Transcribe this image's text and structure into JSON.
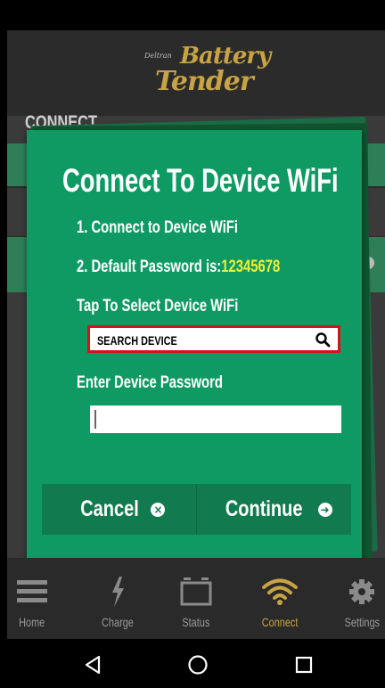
{
  "header": {
    "logo_small": "Deltran",
    "logo_line1": "Battery",
    "logo_line2": "Tender"
  },
  "page": {
    "title": "CONNECT"
  },
  "dialog": {
    "title": "Connect To Device WiFi",
    "step1": "1. Connect to Device WiFi",
    "step2_label": "2. Default Password is:",
    "step2_password": "12345678",
    "select_label": "Tap To Select Device WiFi",
    "search_placeholder": "SEARCH DEVICE",
    "password_label": "Enter Device Password",
    "password_value": "",
    "cancel_label": "Cancel",
    "continue_label": "Continue"
  },
  "tabs": [
    {
      "label": "Home",
      "icon": "menu-icon"
    },
    {
      "label": "Charge",
      "icon": "lightning-icon"
    },
    {
      "label": "Status",
      "icon": "battery-icon"
    },
    {
      "label": "Connect",
      "icon": "wifi-icon",
      "active": true
    },
    {
      "label": "Settings",
      "icon": "gear-icon"
    }
  ],
  "colors": {
    "dialog_bg": "#109a63",
    "accent_gold": "#c7a343",
    "password_highlight": "#ecef39",
    "search_border": "#d4131c"
  }
}
